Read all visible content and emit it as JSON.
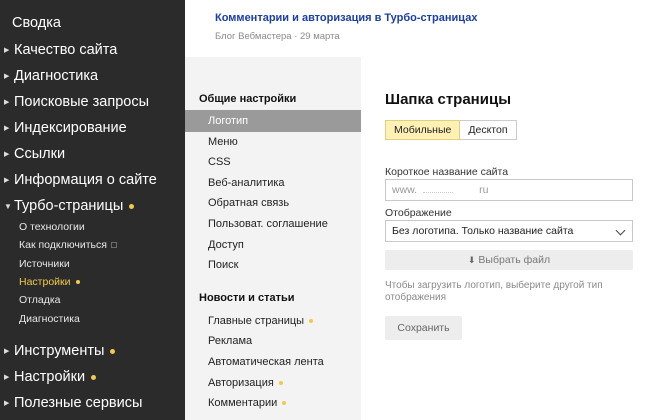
{
  "sidebar": {
    "items": [
      {
        "label": "Сводка"
      },
      {
        "label": "Качество сайта"
      },
      {
        "label": "Диагностика"
      },
      {
        "label": "Поисковые запросы"
      },
      {
        "label": "Индексирование"
      },
      {
        "label": "Ссылки"
      },
      {
        "label": "Информация о сайте"
      },
      {
        "label": "Турбо-страницы"
      },
      {
        "label": "Инструменты"
      },
      {
        "label": "Настройки"
      },
      {
        "label": "Полезные сервисы"
      }
    ],
    "sub_items": [
      {
        "label": "О технологии"
      },
      {
        "label": "Как подключиться"
      },
      {
        "label": "Источники"
      },
      {
        "label": "Настройки"
      },
      {
        "label": "Отладка"
      },
      {
        "label": "Диагностика"
      }
    ]
  },
  "top_article": {
    "title": "Комментарии и авторизация в Турбо-страницах",
    "meta": "Блог Вебмастера · 29 марта"
  },
  "settings_nav": {
    "general_heading": "Общие настройки",
    "general_items": [
      {
        "label": "Логотип"
      },
      {
        "label": "Меню"
      },
      {
        "label": "CSS"
      },
      {
        "label": "Веб-аналитика"
      },
      {
        "label": "Обратная связь"
      },
      {
        "label": "Пользоват. соглашение"
      },
      {
        "label": "Доступ"
      },
      {
        "label": "Поиск"
      }
    ],
    "news_heading": "Новости и статьи",
    "news_items": [
      {
        "label": "Главные страницы"
      },
      {
        "label": "Реклама"
      },
      {
        "label": "Автоматическая лента"
      },
      {
        "label": "Авторизация"
      },
      {
        "label": "Комментарии"
      }
    ]
  },
  "content": {
    "title": "Шапка страницы",
    "tabs": [
      {
        "label": "Мобильные"
      },
      {
        "label": "Десктоп"
      }
    ],
    "short_name_label": "Короткое название сайта",
    "short_name_prefix": "www.",
    "short_name_suffix": "ru",
    "display_label": "Отображение",
    "display_value": "Без логотипа. Только название сайта",
    "upload_label": "Выбрать файл",
    "hint": "Чтобы загрузить логотип, выберите другой тип отображения",
    "save_label": "Сохранить"
  },
  "colors": {
    "sidebar_bg": "#2b2b2b",
    "accent_dot": "#f2c94c",
    "link": "#1a3ea8",
    "active_nav_bg": "#9a9a9a",
    "active_tab_bg": "#fff0b3"
  }
}
